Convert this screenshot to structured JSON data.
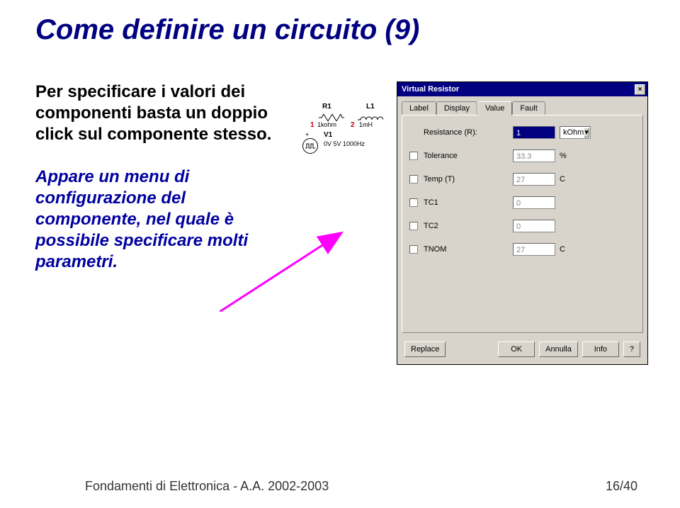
{
  "slide": {
    "title": "Come definire un circuito (9)",
    "paragraph1": "Per specificare i valori dei componenti basta un doppio click sul componente stesso.",
    "paragraph2": "Appare un menu di configurazione del componente, nel quale è possibile specificare molti parametri.",
    "footer_left": "Fondamenti di Elettronica - A.A. 2002-2003",
    "footer_right": "16/40"
  },
  "schematic": {
    "r_label": "R1",
    "r_val": "1kohm",
    "l_label": "L1",
    "l_val": "1mH",
    "v_label": "V1",
    "v_val": "0V 5V 1000Hz",
    "node1": "1",
    "node2": "2"
  },
  "dialog": {
    "title": "Virtual Resistor",
    "close": "×",
    "tabs": {
      "label": "Label",
      "display": "Display",
      "value": "Value",
      "fault": "Fault"
    },
    "params": {
      "resistance": {
        "label": "Resistance (R):",
        "value": "1",
        "unit": "kOhm"
      },
      "tolerance": {
        "label": "Tolerance",
        "value": "33.3",
        "unit": "%"
      },
      "temp": {
        "label": "Temp (T)",
        "value": "27",
        "unit": "C"
      },
      "tc1": {
        "label": "TC1",
        "value": "0",
        "unit": ""
      },
      "tc2": {
        "label": "TC2",
        "value": "0",
        "unit": ""
      },
      "tnom": {
        "label": "TNOM",
        "value": "27",
        "unit": "C"
      }
    },
    "buttons": {
      "replace": "Replace",
      "ok": "OK",
      "cancel": "Annulla",
      "info": "Info",
      "help": "?"
    }
  }
}
